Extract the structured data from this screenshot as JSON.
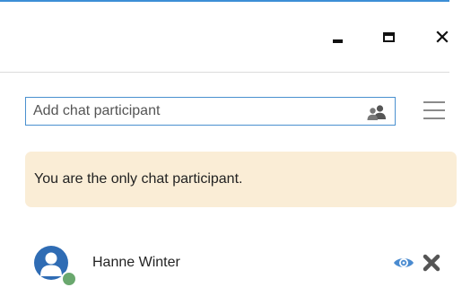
{
  "window": {
    "controls": {
      "minimize_icon": "minimize-icon",
      "maximize_icon": "maximize-icon",
      "close_glyph": "✕"
    }
  },
  "participants_panel": {
    "search": {
      "placeholder": "Add chat participant",
      "value": "",
      "icon": "people-icon"
    },
    "menu_icon": "hamburger-menu-icon",
    "notice": "You are the only chat participant.",
    "participants": [
      {
        "name": "Hanne Winter",
        "presence": "online",
        "actions": [
          "eye-icon",
          "remove-icon"
        ]
      }
    ]
  },
  "colors": {
    "accent": "#3c8fd6",
    "avatar": "#2f6cb4",
    "presence_online": "#6aa86e",
    "notice_background": "#faedd6",
    "eye_icon": "#4a8bd0",
    "remove_icon": "#555555"
  }
}
